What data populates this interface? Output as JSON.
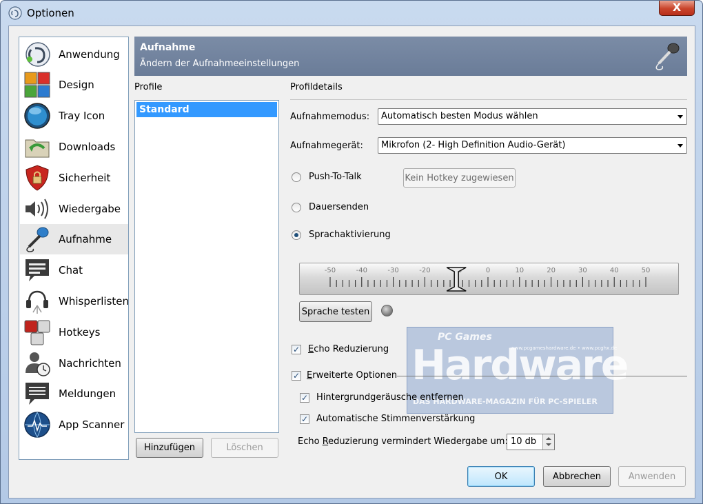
{
  "window": {
    "title": "Optionen",
    "close_label": "X"
  },
  "sidebar": {
    "items": [
      {
        "label": "Anwendung",
        "icon": "teamspeak-icon"
      },
      {
        "label": "Design",
        "icon": "design-tiles-icon"
      },
      {
        "label": "Tray Icon",
        "icon": "tray-orb-icon"
      },
      {
        "label": "Downloads",
        "icon": "downloads-folder-icon"
      },
      {
        "label": "Sicherheit",
        "icon": "security-shield-icon"
      },
      {
        "label": "Wiedergabe",
        "icon": "speaker-icon"
      },
      {
        "label": "Aufnahme",
        "icon": "microphone-icon"
      },
      {
        "label": "Chat",
        "icon": "chat-bubble-icon"
      },
      {
        "label": "Whisperlisten",
        "icon": "headset-icon"
      },
      {
        "label": "Hotkeys",
        "icon": "hotkeys-icon"
      },
      {
        "label": "Nachrichten",
        "icon": "messages-user-icon"
      },
      {
        "label": "Meldungen",
        "icon": "notifications-bubble-icon"
      },
      {
        "label": "App Scanner",
        "icon": "app-scanner-globe-icon"
      }
    ],
    "selected": "Aufnahme"
  },
  "banner": {
    "title": "Aufnahme",
    "subtitle": "Ändern der Aufnahmeeinstellungen"
  },
  "profiles": {
    "heading": "Profile",
    "items": [
      "Standard"
    ],
    "add_label": "Hinzufügen",
    "delete_label": "Löschen"
  },
  "details": {
    "heading": "Profildetails",
    "mode_label": "Aufnahmemodus:",
    "mode_value": "Automatisch besten Modus wählen",
    "device_label": "Aufnahmegerät:",
    "device_value": "Mikrofon (2- High Definition Audio-Gerät)",
    "ptt_label": "Push-To-Talk",
    "hotkey_label": "Kein Hotkey zugewiesen",
    "continuous_label": "Dauersenden",
    "voice_activation_label": "Sprachaktivierung",
    "selected_mode": "Sprachaktivierung",
    "slider_ticks": [
      "-50",
      "-40",
      "-30",
      "-20",
      "-10",
      "0",
      "10",
      "20",
      "30",
      "40",
      "50"
    ],
    "slider_value": -10,
    "test_label": "Sprache testen",
    "echo_reduction_label_pre": "",
    "echo_reduction_label_key": "E",
    "echo_reduction_label_post": "cho Reduzierung",
    "echo_reduction_checked": true,
    "advanced_key": "E",
    "advanced_post": "rweiterte Optionen",
    "advanced_checked": true,
    "noise_label": "Hintergrundgeräusche entfernen",
    "noise_checked": true,
    "agc_label": "Automatische Stimmenverstärkung",
    "agc_checked": true,
    "echo_amount_pre": "Echo ",
    "echo_amount_key": "R",
    "echo_amount_post": "eduzierung vermindert Wiedergabe um:",
    "echo_amount_value": "10 db"
  },
  "watermark": {
    "top": "PC Games",
    "big": "Hardware",
    "small": "DAS HARDWARE-MAGAZIN FÜR PC-SPIELER",
    "url": "www.pcgameshardware.de • www.pcghx.de"
  },
  "footer": {
    "ok_label": "OK",
    "cancel_label": "Abbrechen",
    "apply_label": "Anwenden"
  },
  "colors": {
    "selection": "#3399ff",
    "banner": "#7386a3",
    "accent": "#1e4e79"
  }
}
